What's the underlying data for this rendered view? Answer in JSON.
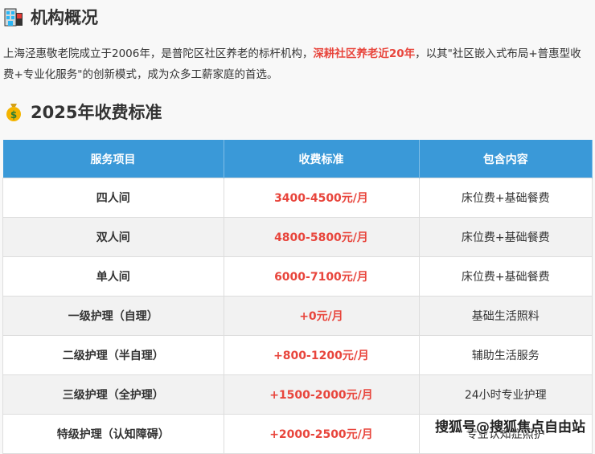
{
  "section1": {
    "icon": "hospital-icon",
    "title": "机构概况"
  },
  "intro": {
    "before": "上海泾惠敬老院成立于2006年，是普陀区社区养老的标杆机构，",
    "highlight": "深耕社区养老近20年",
    "after": "，以其\"社区嵌入式布局+普惠型收费+专业化服务\"的创新模式，成为众多工薪家庭的首选。"
  },
  "section2": {
    "icon": "money-bag-icon",
    "title": "2025年收费标准"
  },
  "table": {
    "headers": [
      "服务项目",
      "收费标准",
      "包含内容"
    ],
    "rows": [
      {
        "item": "四人间",
        "price": "3400-4500元/月",
        "content": "床位费+基础餐费"
      },
      {
        "item": "双人间",
        "price": "4800-5800元/月",
        "content": "床位费+基础餐费"
      },
      {
        "item": "单人间",
        "price": "6000-7100元/月",
        "content": "床位费+基础餐费"
      },
      {
        "item": "一级护理（自理）",
        "price": "+0元/月",
        "content": "基础生活照料"
      },
      {
        "item": "二级护理（半自理）",
        "price": "+800-1200元/月",
        "content": "辅助生活服务"
      },
      {
        "item": "三级护理（全护理）",
        "price": "+1500-2000元/月",
        "content": "24小时专业护理"
      },
      {
        "item": "特级护理（认知障碍）",
        "price": "+2000-2500元/月",
        "content": "专业认知症照护"
      }
    ]
  },
  "watermark": "搜狐号@搜狐焦点自由站",
  "colors": {
    "header": "#3a99d8",
    "accent": "#e8453c"
  }
}
